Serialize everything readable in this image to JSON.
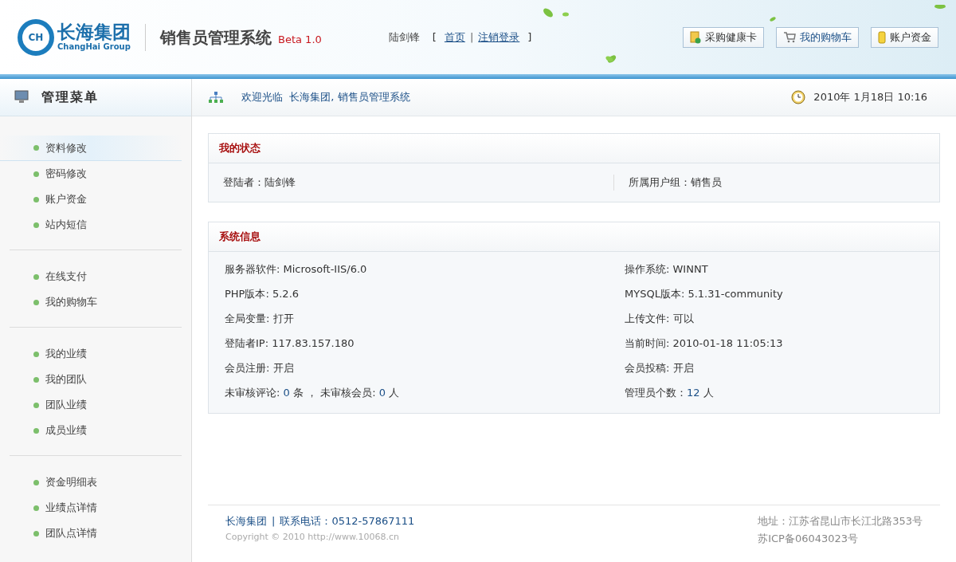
{
  "header": {
    "logo_cn": "长海集团",
    "logo_en": "ChangHai Group",
    "logo_mark": "CH",
    "system_title": "销售员管理系统",
    "version": "Beta 1.0",
    "user": "陆剑锋",
    "links": [
      "首页",
      "注销登录"
    ],
    "link_brackets": [
      "[",
      "]"
    ],
    "link_separator": "|",
    "buttons": [
      {
        "label": "采购健康卡",
        "kind": "card"
      },
      {
        "label": "我的购物车",
        "kind": "cart"
      },
      {
        "label": "账户资金",
        "kind": "coin"
      }
    ]
  },
  "sidebar": {
    "title": "管理菜单",
    "groups": [
      [
        {
          "label": "资料修改",
          "selected": true
        },
        {
          "label": "密码修改",
          "selected": false
        },
        {
          "label": "账户资金",
          "selected": false
        },
        {
          "label": "站内短信",
          "selected": false
        }
      ],
      [
        {
          "label": "在线支付",
          "selected": false
        },
        {
          "label": "我的购物车",
          "selected": false
        }
      ],
      [
        {
          "label": "我的业绩",
          "selected": false
        },
        {
          "label": "我的团队",
          "selected": false
        },
        {
          "label": "团队业绩",
          "selected": false
        },
        {
          "label": "成员业绩",
          "selected": false
        }
      ],
      [
        {
          "label": "资金明细表",
          "selected": false
        },
        {
          "label": "业绩点详情",
          "selected": false
        },
        {
          "label": "团队点详情",
          "selected": false
        }
      ]
    ]
  },
  "topbar": {
    "welcome": "欢迎光临  长海集团, 销售员管理系统",
    "datetime": "2010年 1月18日 10:16"
  },
  "status_panel": {
    "title": "我的状态",
    "left": "登陆者：陆剑锋",
    "right": "所属用户组：销售员"
  },
  "system_panel": {
    "title": "系统信息",
    "rows": [
      [
        [
          {
            "text": "服务器软件: Microsoft-IIS/6.0",
            "kind": "plain"
          }
        ],
        [
          {
            "text": "操作系统: WINNT",
            "kind": "plain"
          }
        ]
      ],
      [
        [
          {
            "text": "PHP版本: 5.2.6",
            "kind": "plain"
          }
        ],
        [
          {
            "text": "MYSQL版本: 5.1.31-community",
            "kind": "plain"
          }
        ]
      ],
      [
        [
          {
            "text": "全局变量: 打开",
            "kind": "plain"
          }
        ],
        [
          {
            "text": "上传文件: 可以",
            "kind": "plain"
          }
        ]
      ],
      [
        [
          {
            "text": "登陆者IP: 117.83.157.180",
            "kind": "plain"
          }
        ],
        [
          {
            "text": "当前时间: 2010-01-18 11:05:13",
            "kind": "plain"
          }
        ]
      ],
      [
        [
          {
            "text": "会员注册: 开启",
            "kind": "plain"
          }
        ],
        [
          {
            "text": "会员投稿: 开启",
            "kind": "plain"
          }
        ]
      ],
      [
        [
          {
            "text": "未审核评论: ",
            "kind": "plain"
          },
          {
            "text": "0",
            "kind": "count"
          },
          {
            "text": " 条 ， 未审核会员: ",
            "kind": "plain"
          },
          {
            "text": "0",
            "kind": "count"
          },
          {
            "text": " 人",
            "kind": "plain"
          }
        ],
        [
          {
            "text": "管理员个数：",
            "kind": "plain"
          },
          {
            "text": "12",
            "kind": "count"
          },
          {
            "text": " 人",
            "kind": "plain"
          }
        ]
      ]
    ]
  },
  "footer": {
    "company": "长海集团",
    "separator": "|",
    "phone": "联系电话：0512-57867111",
    "copyright": "Copyright © 2010 http://www.10068.cn",
    "address": "地址：江苏省昆山市长江北路353号",
    "icp": "苏ICP备06043023号"
  }
}
